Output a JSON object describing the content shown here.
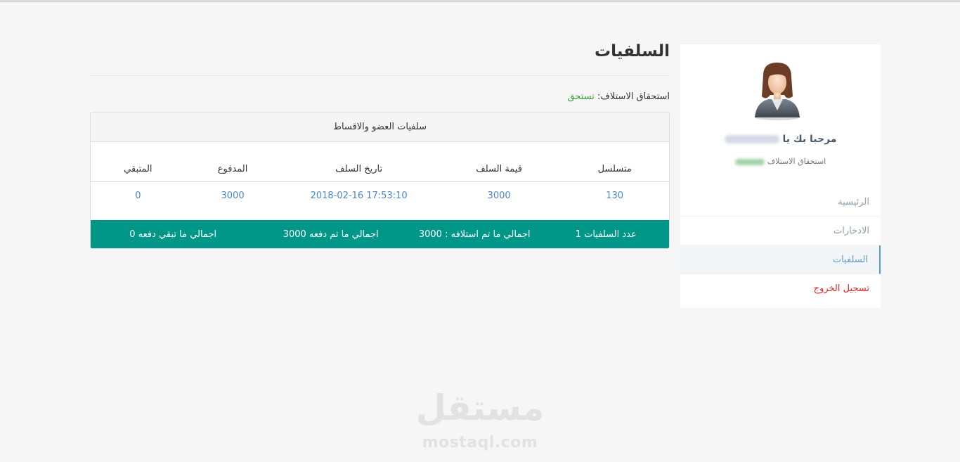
{
  "page": {
    "title": "السلفيات",
    "eligibility_label": "استحقاق الاستلاف:",
    "eligibility_value": "تستحق"
  },
  "sidebar": {
    "welcome_text": "مرحبا بك يا",
    "eligibility_label": "استحقاق الاستلاف",
    "items": [
      {
        "label": "الرئيسية"
      },
      {
        "label": "الادخارات"
      },
      {
        "label": "السلفيات",
        "active": true
      },
      {
        "label": "تسجيل الخروج"
      }
    ]
  },
  "panel": {
    "heading": "سلفيات العضو والاقساط",
    "columns": [
      "متسلسل",
      "قيمة السلف",
      "تاريخ السلف",
      "المدفوع",
      "المتبقي"
    ],
    "rows": [
      [
        "130",
        "3000",
        "2018-02-16 17:53:10",
        "3000",
        "0"
      ]
    ],
    "footer": {
      "count": "عدد السلفيات 1",
      "total_borrowed": "اجمالي ما تم استلافه : 3000",
      "total_paid": "اجمالي ما تم دفعه 3000",
      "total_remaining": "اجمالي ما تبقي دفعه 0"
    }
  },
  "watermark": {
    "arabic": "مستقل",
    "latin": "mostaql.com"
  },
  "colors": {
    "accent_green": "#009688",
    "active_blue": "#5b9bd1",
    "logout_red": "#e02222",
    "eligible_green": "#3c9a3c"
  }
}
